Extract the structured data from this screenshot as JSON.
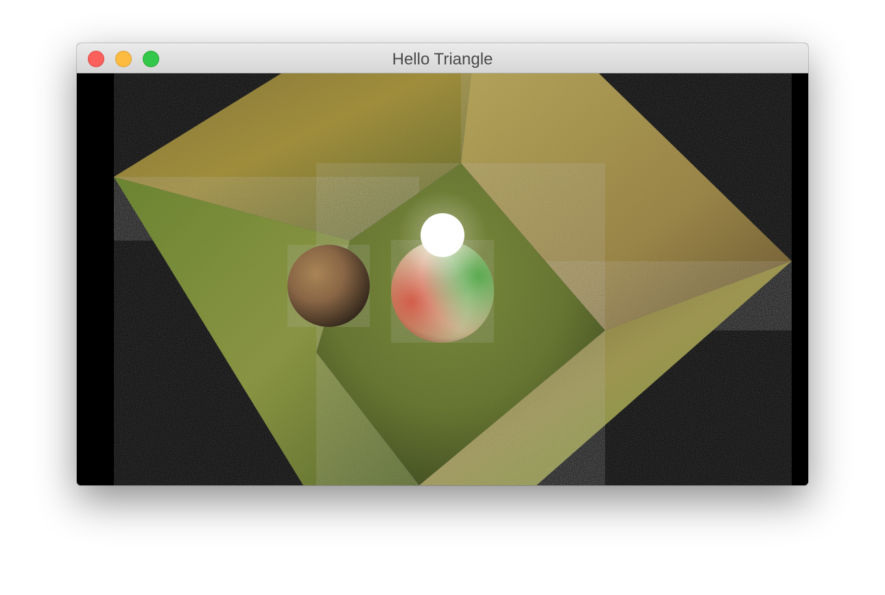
{
  "window": {
    "title": "Hello Triangle",
    "controls": {
      "close": "close-icon",
      "minimize": "minimize-icon",
      "zoom": "zoom-icon"
    }
  },
  "scene": {
    "background": "#000000",
    "light_color": "#ffffff",
    "wall_colors": [
      "#b7ad5c",
      "#8f9a46",
      "#a08848"
    ],
    "floor_color": "#7d8b3d",
    "sphere_left_color": "#8f6a48",
    "sphere_right_colors": [
      "#d23a2c",
      "#f1e6cc",
      "#2c9a2c"
    ]
  }
}
